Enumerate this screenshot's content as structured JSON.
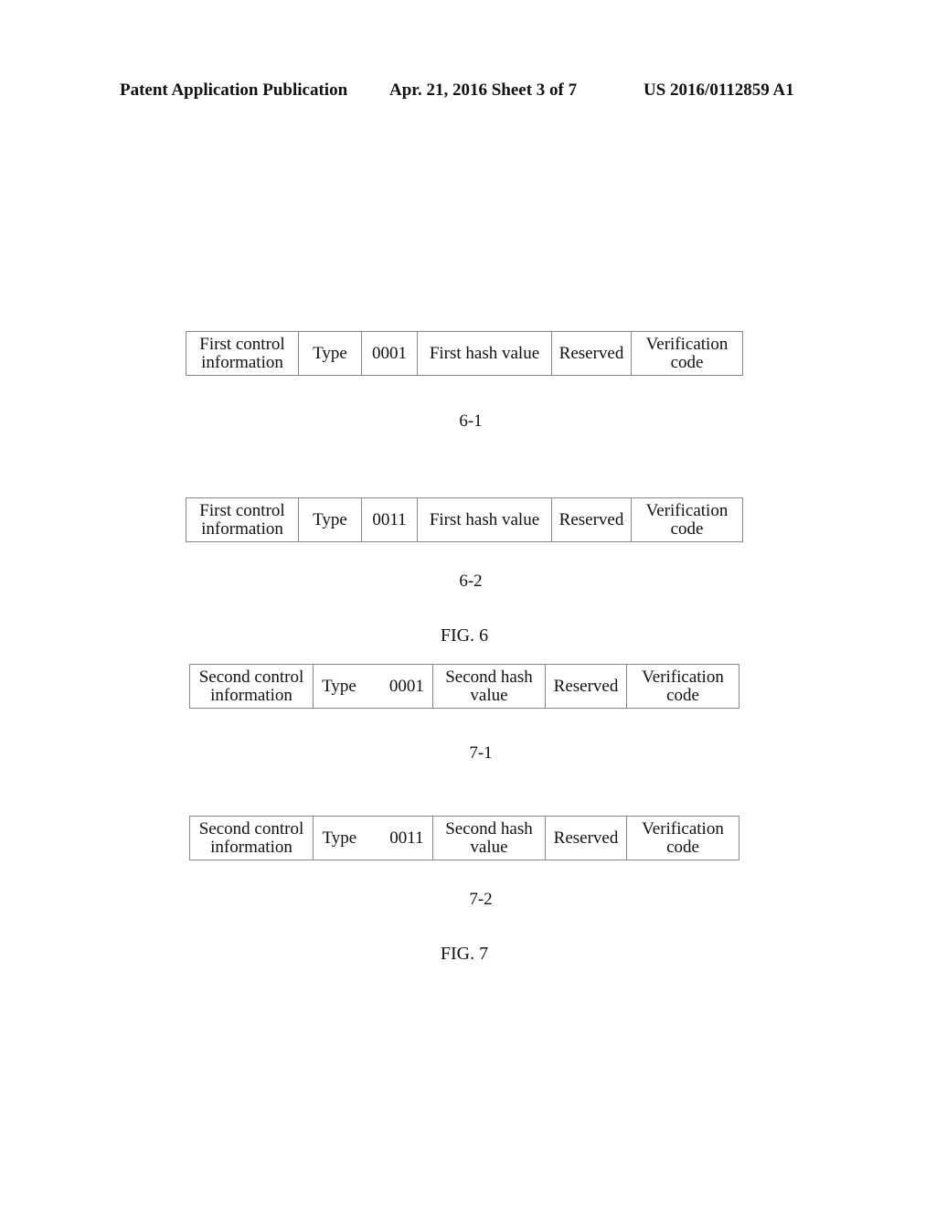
{
  "header": {
    "left": "Patent Application Publication",
    "middle": "Apr. 21, 2016  Sheet 3 of 7",
    "right": "US 2016/0112859 A1"
  },
  "fig6": {
    "caption": "FIG. 6",
    "tables": [
      {
        "label": "6-1",
        "cells": [
          "First control\ninformation",
          "Type",
          "0001",
          "First hash value",
          "Reserved",
          "Verification\ncode"
        ]
      },
      {
        "label": "6-2",
        "cells": [
          "First control\ninformation",
          "Type",
          "0011",
          "First hash value",
          "Reserved",
          "Verification\ncode"
        ]
      }
    ]
  },
  "fig7": {
    "caption": "FIG. 7",
    "tables": [
      {
        "label": "7-1",
        "cells": [
          "Second control\ninformation",
          "Type",
          "0001",
          "Second hash\nvalue",
          "Reserved",
          "Verification\ncode"
        ]
      },
      {
        "label": "7-2",
        "cells": [
          "Second control\ninformation",
          "Type",
          "0011",
          "Second hash\nvalue",
          "Reserved",
          "Verification\ncode"
        ]
      }
    ]
  }
}
